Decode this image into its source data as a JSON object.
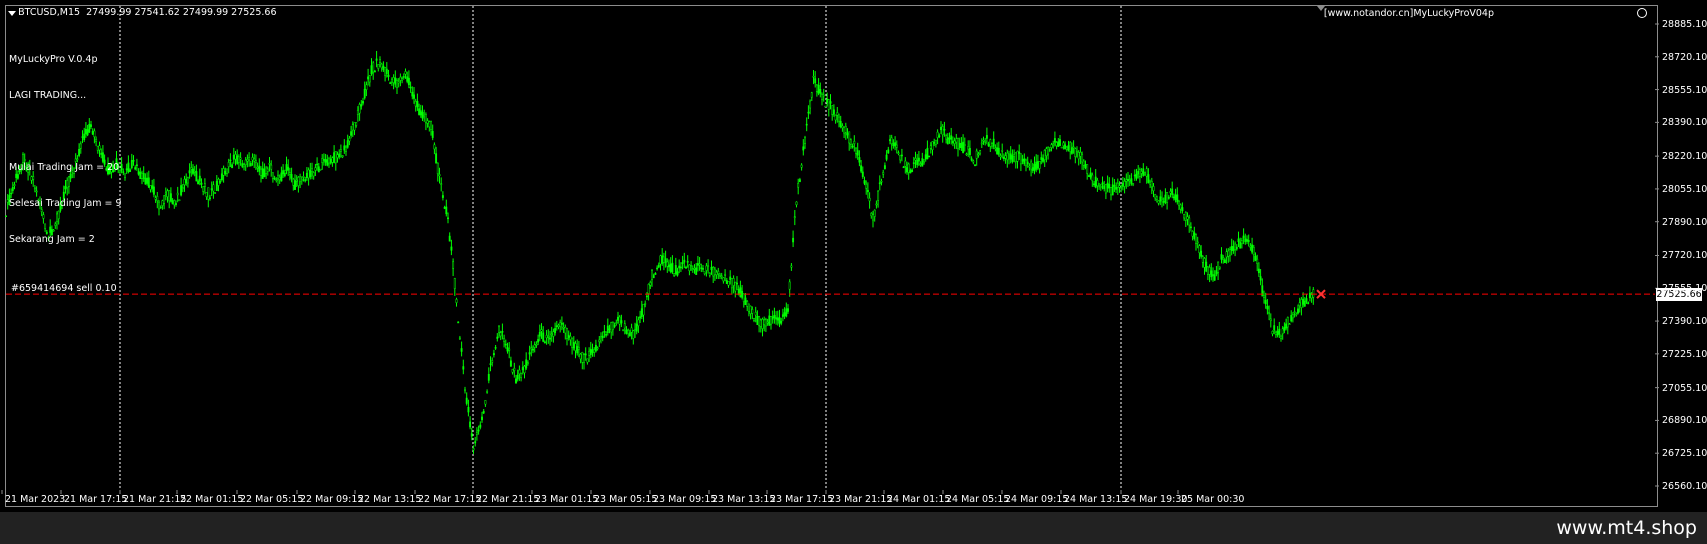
{
  "header": {
    "symbol": "BTCUSD,M15",
    "ohlc": "27499.99 27541.62 27499.99 27525.66"
  },
  "ea": {
    "lines": [
      "MyLuckyPro V.0.4p",
      "LAGI TRADING...",
      "",
      "Mulai Trading Jam = 20",
      "Selesai Trading Jam = 9",
      "Sekarang Jam = 2"
    ]
  },
  "brand_label": "[www.notandor.cn]MyLuckyProV04p",
  "order_label": "#659414694 sell 0.10",
  "current_price": "27525.66",
  "watermark": "www.mt4.shop",
  "icons": [
    "menu-arrow-icon",
    "smiley-icon",
    "trade-arrow-icon",
    "period-marker-icon"
  ],
  "colors": {
    "background": "#000000",
    "candle": "#00ff00",
    "order_line": "#ff0000",
    "grid": "#ffffff",
    "trade_marker": "#ff3333"
  },
  "chart_data": {
    "type": "line",
    "style": "candlestick",
    "ylim": [
      26560.1,
      28885.1
    ],
    "y_ticks": [
      "28885.10",
      "28720.10",
      "28555.10",
      "28390.10",
      "28220.10",
      "28055.10",
      "27890.10",
      "27720.10",
      "27555.10",
      "27390.10",
      "27225.10",
      "27055.10",
      "26890.10",
      "26725.10",
      "26560.10"
    ],
    "x_ticks": [
      "21 Mar 2023",
      "21 Mar 17:15",
      "21 Mar 21:15",
      "22 Mar 01:15",
      "22 Mar 05:15",
      "22 Mar 09:15",
      "22 Mar 13:15",
      "22 Mar 17:15",
      "22 Mar 21:15",
      "23 Mar 01:15",
      "23 Mar 05:15",
      "23 Mar 09:15",
      "23 Mar 13:15",
      "23 Mar 17:15",
      "23 Mar 21:15",
      "24 Mar 01:15",
      "24 Mar 05:15",
      "24 Mar 09:15",
      "24 Mar 13:15",
      "24 Mar 19:30",
      "25 Mar 00:30"
    ],
    "period_separators": [
      "21 Mar 21:15",
      "22 Mar 21:15",
      "23 Mar 21:15",
      "24 Mar 19:30"
    ],
    "order_price": 27525.66,
    "series": [
      {
        "points": [
          [
            0,
            27950
          ],
          [
            5,
            28080
          ],
          [
            10,
            28200
          ],
          [
            15,
            28120
          ],
          [
            20,
            27980
          ],
          [
            25,
            27820
          ],
          [
            30,
            27900
          ],
          [
            35,
            28050
          ],
          [
            40,
            28150
          ],
          [
            45,
            28300
          ],
          [
            50,
            28380
          ],
          [
            55,
            28250
          ],
          [
            60,
            28150
          ],
          [
            65,
            28180
          ],
          [
            70,
            28140
          ],
          [
            75,
            28190
          ],
          [
            80,
            28120
          ],
          [
            85,
            28080
          ],
          [
            90,
            27970
          ],
          [
            95,
            28030
          ],
          [
            100,
            27990
          ],
          [
            105,
            28080
          ],
          [
            110,
            28150
          ],
          [
            115,
            28080
          ],
          [
            120,
            28020
          ],
          [
            125,
            28090
          ],
          [
            130,
            28160
          ],
          [
            135,
            28210
          ],
          [
            140,
            28180
          ],
          [
            145,
            28200
          ],
          [
            150,
            28130
          ],
          [
            155,
            28160
          ],
          [
            160,
            28100
          ],
          [
            165,
            28150
          ],
          [
            170,
            28080
          ],
          [
            175,
            28110
          ],
          [
            180,
            28130
          ],
          [
            185,
            28180
          ],
          [
            190,
            28200
          ],
          [
            195,
            28220
          ],
          [
            200,
            28260
          ],
          [
            205,
            28380
          ],
          [
            210,
            28500
          ],
          [
            215,
            28650
          ],
          [
            220,
            28700
          ],
          [
            225,
            28620
          ],
          [
            230,
            28580
          ],
          [
            235,
            28640
          ],
          [
            240,
            28500
          ],
          [
            245,
            28420
          ],
          [
            250,
            28380
          ],
          [
            255,
            28100
          ],
          [
            260,
            27900
          ],
          [
            265,
            27500
          ],
          [
            270,
            27050
          ],
          [
            275,
            26750
          ],
          [
            280,
            26900
          ],
          [
            285,
            27150
          ],
          [
            290,
            27350
          ],
          [
            295,
            27250
          ],
          [
            300,
            27100
          ],
          [
            305,
            27150
          ],
          [
            310,
            27250
          ],
          [
            315,
            27320
          ],
          [
            320,
            27280
          ],
          [
            325,
            27380
          ],
          [
            330,
            27330
          ],
          [
            335,
            27250
          ],
          [
            340,
            27200
          ],
          [
            345,
            27230
          ],
          [
            350,
            27300
          ],
          [
            355,
            27350
          ],
          [
            360,
            27400
          ],
          [
            365,
            27350
          ],
          [
            370,
            27320
          ],
          [
            375,
            27450
          ],
          [
            380,
            27620
          ],
          [
            385,
            27700
          ],
          [
            390,
            27660
          ],
          [
            395,
            27640
          ],
          [
            400,
            27680
          ],
          [
            405,
            27650
          ],
          [
            410,
            27660
          ],
          [
            415,
            27640
          ],
          [
            420,
            27630
          ],
          [
            425,
            27600
          ],
          [
            430,
            27560
          ],
          [
            435,
            27500
          ],
          [
            440,
            27420
          ],
          [
            445,
            27370
          ],
          [
            450,
            27400
          ],
          [
            455,
            27380
          ],
          [
            460,
            27450
          ],
          [
            465,
            28000
          ],
          [
            470,
            28300
          ],
          [
            475,
            28600
          ],
          [
            480,
            28520
          ],
          [
            485,
            28470
          ],
          [
            490,
            28400
          ],
          [
            495,
            28330
          ],
          [
            500,
            28250
          ],
          [
            505,
            28100
          ],
          [
            510,
            27900
          ],
          [
            515,
            28100
          ],
          [
            520,
            28300
          ],
          [
            525,
            28250
          ],
          [
            530,
            28150
          ],
          [
            535,
            28180
          ],
          [
            540,
            28200
          ],
          [
            545,
            28280
          ],
          [
            550,
            28350
          ],
          [
            555,
            28300
          ],
          [
            560,
            28280
          ],
          [
            565,
            28250
          ],
          [
            570,
            28200
          ],
          [
            575,
            28300
          ],
          [
            580,
            28290
          ],
          [
            585,
            28230
          ],
          [
            590,
            28200
          ],
          [
            595,
            28220
          ],
          [
            600,
            28190
          ],
          [
            605,
            28150
          ],
          [
            610,
            28210
          ],
          [
            615,
            28280
          ],
          [
            620,
            28300
          ],
          [
            625,
            28270
          ],
          [
            630,
            28230
          ],
          [
            635,
            28180
          ],
          [
            640,
            28090
          ],
          [
            645,
            28070
          ],
          [
            650,
            28050
          ],
          [
            655,
            28060
          ],
          [
            660,
            28080
          ],
          [
            665,
            28120
          ],
          [
            670,
            28150
          ],
          [
            675,
            28050
          ],
          [
            680,
            27980
          ],
          [
            685,
            28040
          ],
          [
            690,
            27990
          ],
          [
            695,
            27900
          ],
          [
            700,
            27800
          ],
          [
            705,
            27680
          ],
          [
            710,
            27600
          ],
          [
            715,
            27700
          ],
          [
            720,
            27730
          ],
          [
            725,
            27780
          ],
          [
            730,
            27800
          ],
          [
            735,
            27720
          ],
          [
            740,
            27500
          ],
          [
            745,
            27350
          ],
          [
            750,
            27320
          ],
          [
            755,
            27400
          ],
          [
            760,
            27450
          ],
          [
            765,
            27500
          ],
          [
            770,
            27525.66
          ]
        ]
      }
    ]
  }
}
